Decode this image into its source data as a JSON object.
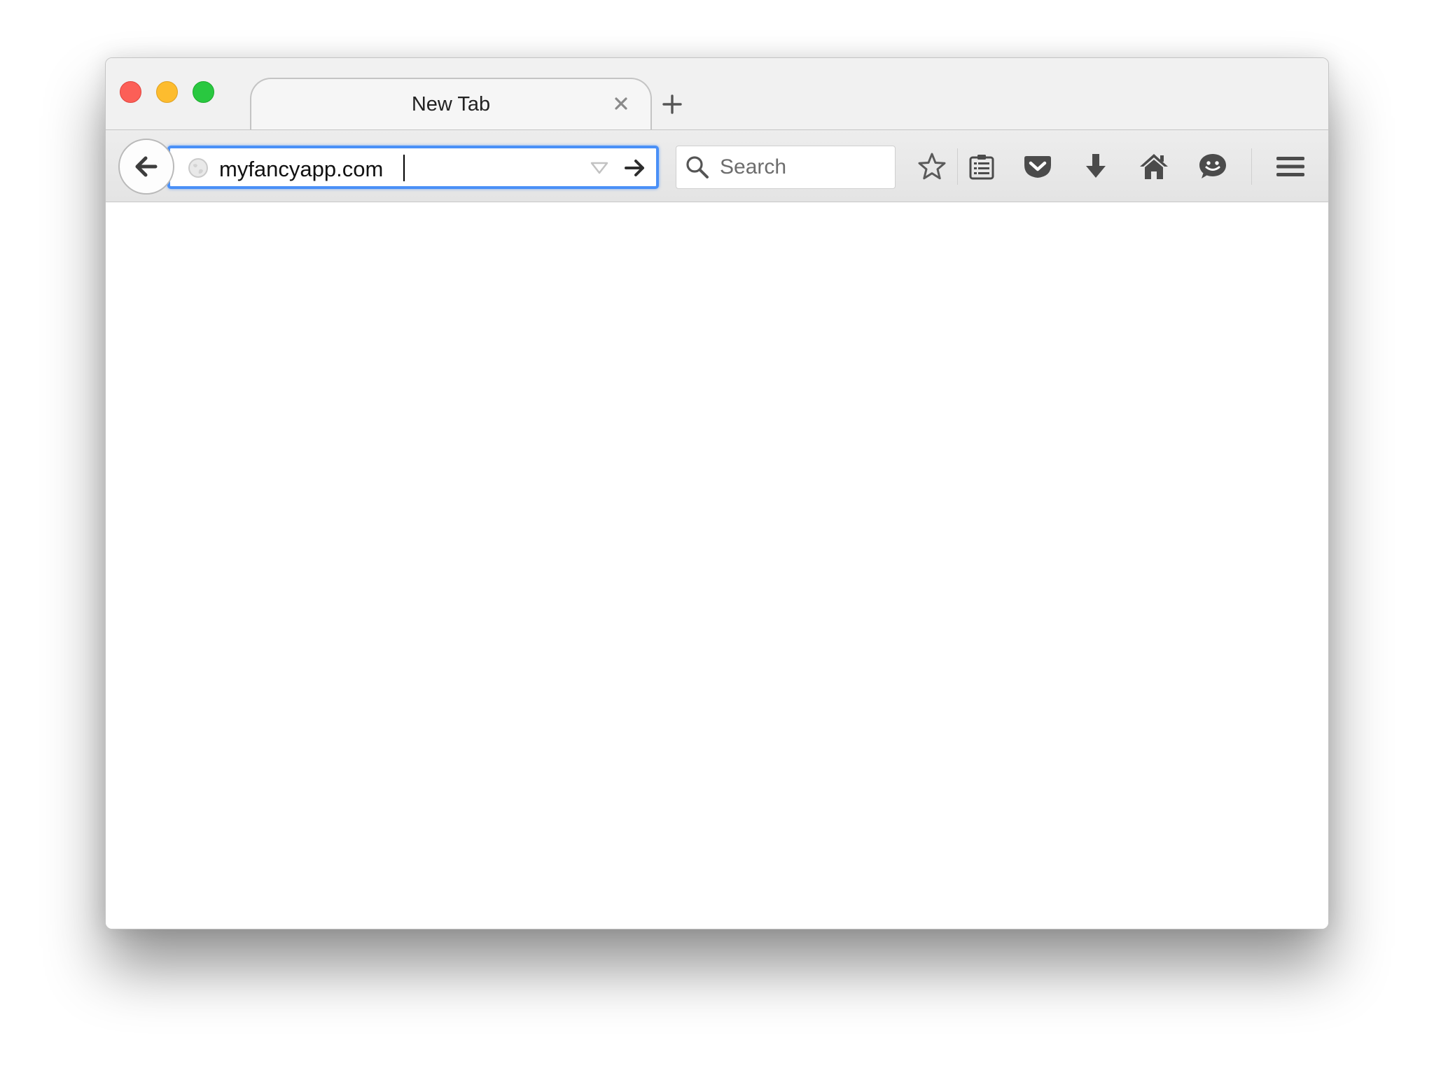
{
  "window": {
    "controls": [
      "close",
      "minimize",
      "zoom"
    ]
  },
  "tab": {
    "title": "New Tab",
    "close_icon": "close-icon",
    "new_tab_icon": "plus-icon"
  },
  "toolbar": {
    "back_icon": "arrow-left-icon",
    "url_value": "myfancyapp.com",
    "site_icon": "globe-icon",
    "dropdown_icon": "triangle-down-icon",
    "go_icon": "arrow-right-icon",
    "search_placeholder": "Search",
    "buttons": [
      "star-icon",
      "reading-list-icon",
      "pocket-icon",
      "download-icon",
      "home-icon",
      "hello-chat-icon",
      "hamburger-menu-icon"
    ]
  },
  "colors": {
    "close": "#fc5f57",
    "minimize": "#fdbc2e",
    "zoom": "#29c840",
    "focus_ring": "#4a90f7",
    "icon": "#4b4b4b"
  }
}
